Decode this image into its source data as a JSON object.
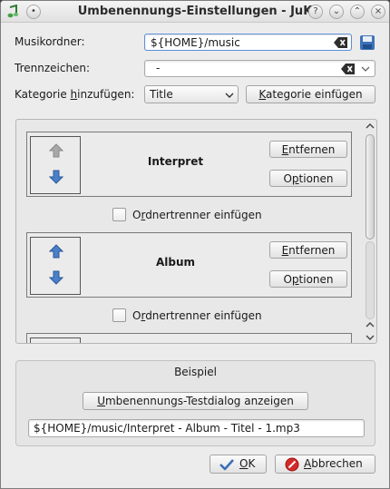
{
  "window": {
    "title": "Umbenennungs-Einstellungen - JuK",
    "buttons": [
      "help",
      "minimize",
      "maximize",
      "close"
    ]
  },
  "music_folder": {
    "label": "Musikordner:",
    "value": "${HOME}/music"
  },
  "separator": {
    "label": "Trennzeichen:",
    "value": "-"
  },
  "add_category": {
    "label": "Kategorie hinzufügen:",
    "selected": "Title",
    "insert_button": "Kategorie einfügen"
  },
  "categories": [
    {
      "name": "Interpret",
      "remove": "Entfernen",
      "options": "Optionen",
      "up_enabled": false
    },
    {
      "name": "Album",
      "remove": "Entfernen",
      "options": "Optionen",
      "up_enabled": true
    }
  ],
  "folder_separator_label": "Ordnertrenner einfügen",
  "example": {
    "title": "Beispiel",
    "test_button": "Umbenennungs-Testdialog anzeigen",
    "result": "${HOME}/music/Interpret - Album - Titel - 1.mp3"
  },
  "footer": {
    "ok": "OK",
    "cancel": "Abbrechen"
  },
  "colors": {
    "arrow_active": "#3b6fb8",
    "arrow_disabled": "#9a9a9a",
    "cancel_icon": "#d42a2a",
    "ok_icon": "#3b6fb8"
  }
}
